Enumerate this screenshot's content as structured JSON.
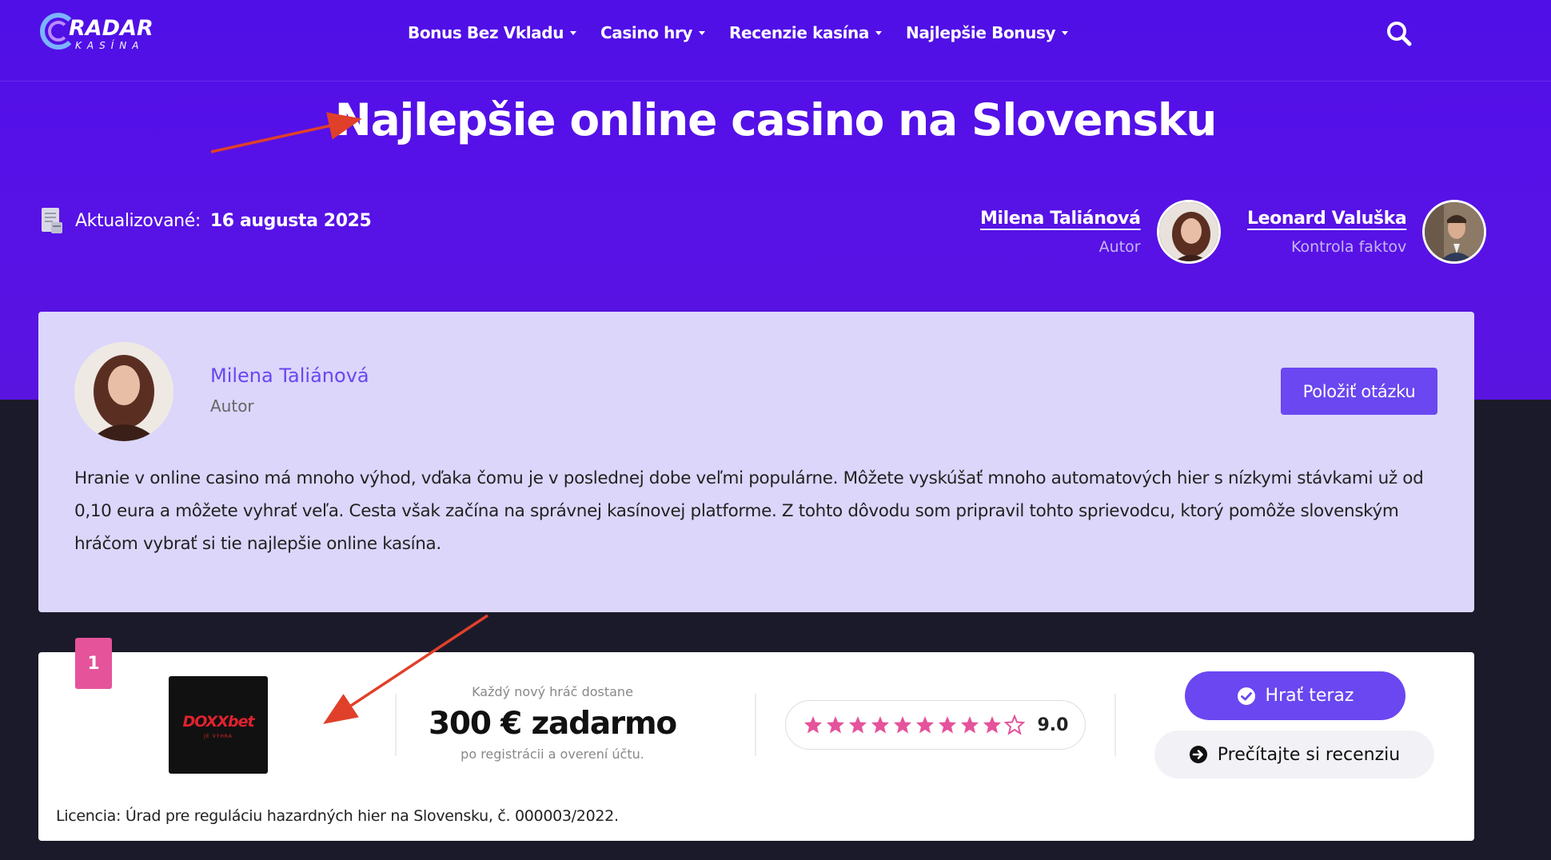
{
  "header": {
    "logo": {
      "word1": "RADAR",
      "word2": "KASÍNA"
    },
    "nav": [
      {
        "label": "Bonus Bez Vkladu"
      },
      {
        "label": "Casino hry"
      },
      {
        "label": "Recenzie kasína"
      },
      {
        "label": "Najlepšie Bonusy"
      }
    ],
    "search_icon": "search-icon"
  },
  "page": {
    "title": "Najlepšie online casino na Slovensku",
    "updated_label": "Aktualizované:",
    "updated_date": "16 augusta 2025"
  },
  "people": {
    "author": {
      "name": "Milena Taliánová",
      "role": "Autor"
    },
    "fact_checker": {
      "name": "Leonard Valuška",
      "role": "Kontrola faktov"
    }
  },
  "author_card": {
    "name": "Milena Taliánová",
    "role": "Autor",
    "button": "Položiť otázku",
    "bio": "Hranie v online casino má mnoho výhod, vďaka čomu je v poslednej dobe veľmi populárne. Môžete vyskúšať mnoho automatových hier s nízkymi stávkami už od 0,10 eura a môžete vyhrať veľa. Cesta však začína na správnej kasínovej platforme. Z tohto dôvodu som pripravil tohto sprievodcu, ktorý pomôže slovenským hráčom vybrať si tie najlepšie online kasína."
  },
  "casino": {
    "rank": "1",
    "logo_text": "DOXXbet",
    "logo_sub": "JE VÝHRA",
    "bonus_intro": "Každý nový hráč dostane",
    "bonus_amount": "300 € zadarmo",
    "bonus_condition": "po registrácii a overení účtu.",
    "rating": 9.0,
    "rating_text": "9.0",
    "stars_total": 10,
    "stars_filled": 9,
    "play_button": "Hrať teraz",
    "review_button": "Prečítajte si recenziu",
    "license": "Licencia: Úrad pre reguláciu hazardných hier na Slovensku, č. 000003/2022."
  },
  "colors": {
    "hero": "#5611e8",
    "accent": "#6a47f0",
    "card_bg": "#dcd6fb",
    "star": "#e5539b",
    "arrow": "#e0402a",
    "dark_bg": "#1b1a2a"
  }
}
